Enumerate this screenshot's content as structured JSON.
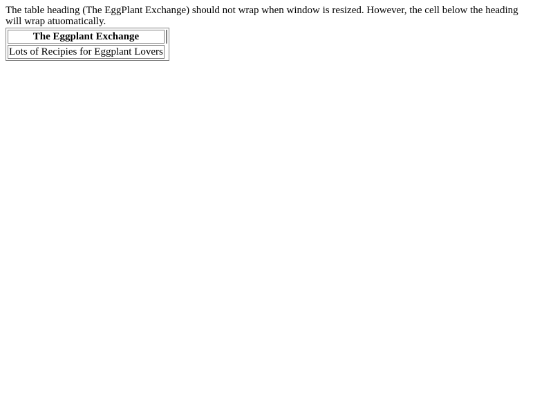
{
  "intro": {
    "text": "The table heading (The EggPlant Exchange) should not wrap when window is resized. However, the cell below the heading will wrap atuomatically."
  },
  "table": {
    "heading": "The Eggplant Exchange",
    "cell": "Lots of Recipies for Eggplant Lovers"
  }
}
